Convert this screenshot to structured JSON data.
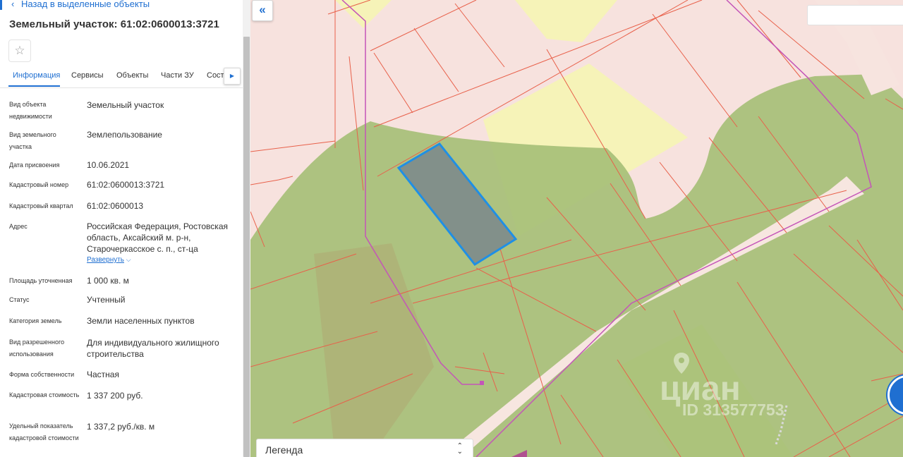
{
  "header": {
    "back_label": "Назад в выделенные объекты",
    "title": "Земельный участок: 61:02:0600013:3721"
  },
  "tabs": [
    {
      "label": "Информация",
      "active": true
    },
    {
      "label": "Сервисы"
    },
    {
      "label": "Объекты"
    },
    {
      "label": "Части ЗУ"
    },
    {
      "label": "Соста"
    }
  ],
  "info": [
    {
      "label": "Вид объекта недвижимости",
      "value": "Земельный участок"
    },
    {
      "label": "Вид земельного участка",
      "value": "Землепользование"
    },
    {
      "label": "Дата присвоения",
      "value": "10.06.2021"
    },
    {
      "label": "Кадастровый номер",
      "value": "61:02:0600013:3721"
    },
    {
      "label": "Кадастровый квартал",
      "value": "61:02:0600013"
    },
    {
      "label": "Адрес",
      "value": "Российская Федерация, Ростовская область, Аксайский м. р-н, Старочеркасское с. п., ст-ца"
    },
    {
      "label": "Площадь уточненная",
      "value": "1 000 кв. м"
    },
    {
      "label": "Статус",
      "value": "Учтенный"
    },
    {
      "label": "Категория земель",
      "value": "Земли населенных пунктов"
    },
    {
      "label": "Вид разрешенного использования",
      "value": "Для индивидуального жилищного строительства"
    },
    {
      "label": "Форма собственности",
      "value": "Частная"
    },
    {
      "label": "Кадастровая стоимость",
      "value": "1 337 200 руб."
    },
    {
      "label": "Удельный показатель кадастровой стоимости",
      "value": "1 337,2 руб./кв. м"
    }
  ],
  "expand_label": "Развернуть",
  "map": {
    "search_value": "",
    "legend_label": "Легенда",
    "watermark": "циан",
    "watermark_id": "ID 313577753",
    "colors": {
      "built_area": "#f7e2de",
      "greenery": "#a6c07a",
      "yellow_zone": "#f6f3b8",
      "selected_fill": "#82908a",
      "selected_stroke": "#1f8fe5",
      "parcel_line": "#e8604a",
      "road": "#f7e6e0",
      "road_line": "#c455b8"
    }
  },
  "icons": {
    "back": "chevron-left-icon",
    "favorite": "star-icon",
    "collapse": "double-chevron-left-icon",
    "legend": "updown-chevron-icon"
  }
}
